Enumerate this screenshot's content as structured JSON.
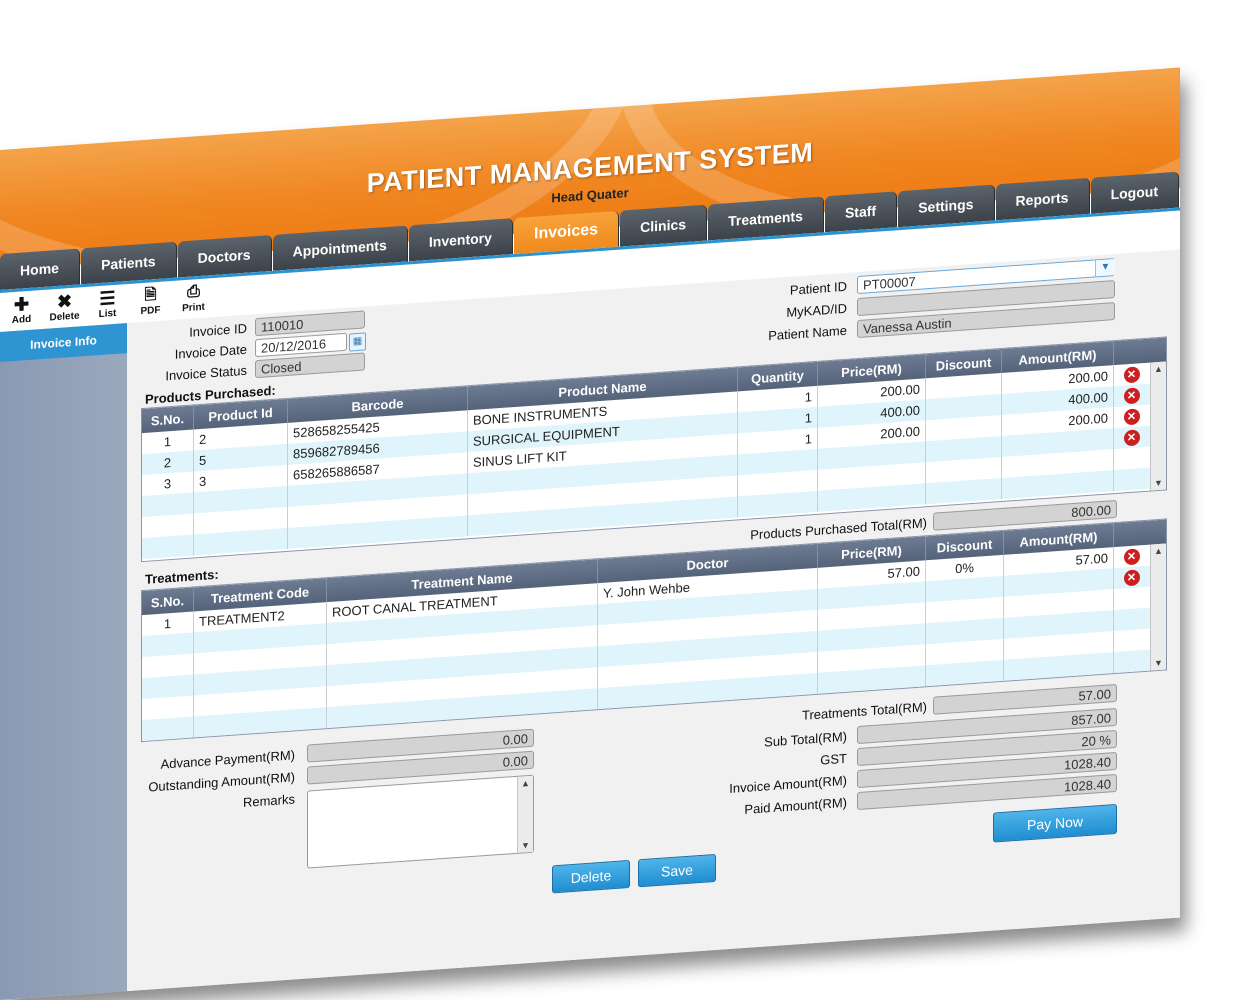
{
  "header": {
    "title": "PATIENT MANAGEMENT SYSTEM",
    "subtitle": "Head Quater"
  },
  "nav": [
    {
      "label": "Home",
      "active": false
    },
    {
      "label": "Patients",
      "active": false
    },
    {
      "label": "Doctors",
      "active": false
    },
    {
      "label": "Appointments",
      "active": false
    },
    {
      "label": "Inventory",
      "active": false
    },
    {
      "label": "Invoices",
      "active": true
    },
    {
      "label": "Clinics",
      "active": false
    },
    {
      "label": "Treatments",
      "active": false
    },
    {
      "label": "Staff",
      "active": false
    },
    {
      "label": "Settings",
      "active": false
    },
    {
      "label": "Reports",
      "active": false
    },
    {
      "label": "Logout",
      "active": false
    }
  ],
  "toolbar": {
    "add": "Add",
    "delete": "Delete",
    "list": "List",
    "pdf": "PDF",
    "print": "Print"
  },
  "sidebar": {
    "items": [
      {
        "label": "Invoice Info"
      }
    ]
  },
  "invoice": {
    "id_label": "Invoice  ID",
    "id_value": "110010",
    "date_label": "Invoice Date",
    "date_value": "20/12/2016",
    "status_label": "Invoice Status",
    "status_value": "Closed"
  },
  "patient": {
    "id_label": "Patient ID",
    "id_value": "PT00007",
    "mykad_label": "MyKAD/ID",
    "mykad_value": "",
    "name_label": "Patient Name",
    "name_value": "Vanessa Austin"
  },
  "products": {
    "section_label": "Products Purchased:",
    "columns": [
      "S.No.",
      "Product Id",
      "Barcode",
      "Product Name",
      "Quantity",
      "Price(RM)",
      "Discount",
      "Amount(RM)"
    ],
    "rows": [
      {
        "sno": "1",
        "product_id": "2",
        "barcode": "528658255425",
        "name": "BONE INSTRUMENTS",
        "qty": "1",
        "price": "200.00",
        "discount": "",
        "amount": "200.00"
      },
      {
        "sno": "2",
        "product_id": "5",
        "barcode": "859682789456",
        "name": "SURGICAL EQUIPMENT",
        "qty": "1",
        "price": "400.00",
        "discount": "",
        "amount": "400.00"
      },
      {
        "sno": "3",
        "product_id": "3",
        "barcode": "658265886587",
        "name": "SINUS LIFT KIT",
        "qty": "1",
        "price": "200.00",
        "discount": "",
        "amount": "200.00"
      }
    ],
    "total_label": "Products Purchased Total(RM)",
    "total_value": "800.00"
  },
  "treatments": {
    "section_label": "Treatments:",
    "columns": [
      "S.No.",
      "Treatment Code",
      "Treatment Name",
      "Doctor",
      "Price(RM)",
      "Discount",
      "Amount(RM)"
    ],
    "rows": [
      {
        "sno": "1",
        "code": "TREATMENT2",
        "name": "ROOT CANAL TREATMENT",
        "doctor": "Y. John Wehbe",
        "price": "57.00",
        "discount": "0%",
        "amount": "57.00"
      }
    ],
    "total_label": "Treatments  Total(RM)",
    "total_value": "57.00"
  },
  "payment": {
    "advance_label": "Advance Payment(RM)",
    "advance_value": "0.00",
    "outstanding_label": "Outstanding Amount(RM)",
    "outstanding_value": "0.00",
    "remarks_label": "Remarks",
    "remarks_value": ""
  },
  "summary": {
    "subtotal_label": "Sub Total(RM)",
    "subtotal_value": "857.00",
    "gst_label": "GST",
    "gst_value": "20 %",
    "invoice_amount_label": "Invoice Amount(RM)",
    "invoice_amount_value": "1028.40",
    "paid_amount_label": "Paid Amount(RM)",
    "paid_amount_value": "1028.40"
  },
  "buttons": {
    "delete": "Delete",
    "save": "Save",
    "pay_now": "Pay Now"
  }
}
